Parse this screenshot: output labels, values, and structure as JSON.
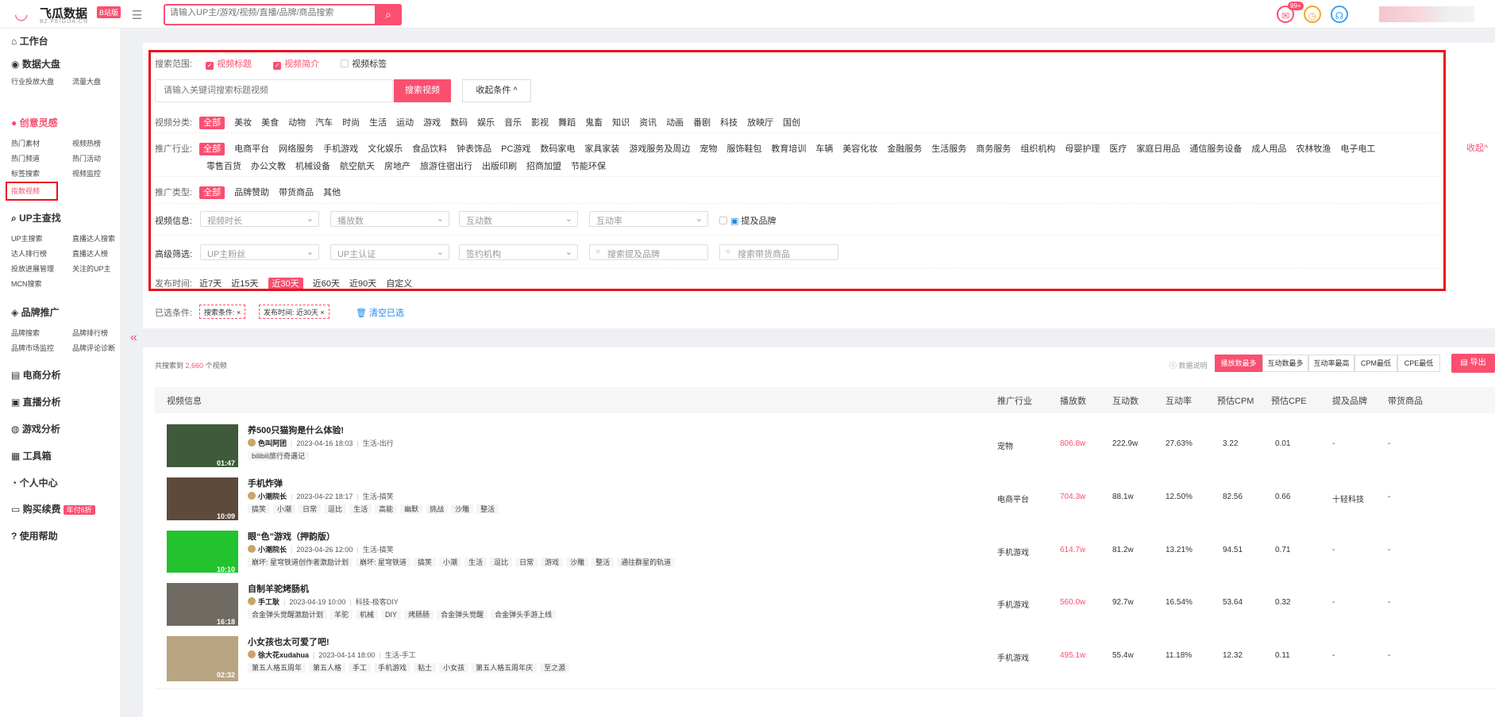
{
  "brand": {
    "name": "飞瓜数据",
    "badge": "B站版",
    "sub": "BZ.FEIGUA.CN"
  },
  "top_search": {
    "placeholder": "请输入UP主/游戏/视频/直播/品牌/商品搜索"
  },
  "top_icons": {
    "msg_count": "99+"
  },
  "sidebar": {
    "workbench": "工作台",
    "dashboard": "数据大盘",
    "dash_items": [
      "行业投放大盘",
      "流量大盘"
    ],
    "creative": "创意灵感",
    "creative_items": [
      "热门素材",
      "视频热榜",
      "热门频道",
      "热门活动",
      "标签搜索",
      "视频监控",
      "指数视频"
    ],
    "upsearch": "UP主查找",
    "up_items": [
      "UP主搜索",
      "直播达人搜索",
      "达人排行榜",
      "直播达人榜",
      "投放进展管理",
      "关注的UP主",
      "MCN搜索"
    ],
    "brand": "品牌推广",
    "brand_items": [
      "品牌搜索",
      "品牌排行榜",
      "品牌市场监控",
      "品牌评论诊断"
    ],
    "ecom": "电商分析",
    "live": "直播分析",
    "game": "游戏分析",
    "tools": "工具箱",
    "personal": "个人中心",
    "renew": "购买续费",
    "renew_tag": "年付6折",
    "help": "使用帮助"
  },
  "filters": {
    "scope_label": "搜索范围:",
    "scope_opts": [
      "视频标题",
      "视频简介",
      "视频标签"
    ],
    "kw_placeholder": "请输入关键词搜索标题视频",
    "kw_btn": "搜索视频",
    "fold_btn": "收起条件 ^",
    "cat_label": "视频分类:",
    "cats": [
      "全部",
      "美妆",
      "美食",
      "动物",
      "汽车",
      "时尚",
      "生活",
      "运动",
      "游戏",
      "数码",
      "娱乐",
      "音乐",
      "影视",
      "舞蹈",
      "鬼畜",
      "知识",
      "资讯",
      "动画",
      "番剧",
      "科技",
      "放映厅",
      "国创"
    ],
    "ind_label": "推广行业:",
    "inds1": [
      "全部",
      "电商平台",
      "网络服务",
      "手机游戏",
      "文化娱乐",
      "食品饮料",
      "钟表饰品",
      "PC游戏",
      "数码家电",
      "家具家装",
      "游戏服务及周边",
      "宠物",
      "服饰鞋包",
      "教育培训",
      "车辆",
      "美容化妆",
      "金融服务",
      "生活服务",
      "商务服务",
      "组织机构",
      "母婴护理",
      "医疗",
      "家庭日用品",
      "通信服务设备",
      "成人用品",
      "农林牧渔",
      "电子电工"
    ],
    "inds2": [
      "零售百货",
      "办公文教",
      "机械设备",
      "航空航天",
      "房地产",
      "旅游住宿出行",
      "出版印刷",
      "招商加盟",
      "节能环保"
    ],
    "ind_fold": "收起^",
    "type_label": "推广类型:",
    "types": [
      "全部",
      "品牌赞助",
      "带货商品",
      "其他"
    ],
    "info_label": "视频信息:",
    "info_sels": [
      "视频时长",
      "播放数",
      "互动数",
      "互动率"
    ],
    "mention_brand": "提及品牌",
    "adv_label": "高级筛选:",
    "adv_sels": [
      "UP主粉丝",
      "UP主认证",
      "签约机构"
    ],
    "adv_search": [
      "搜索提及品牌",
      "搜索带货商品"
    ],
    "time_label": "发布时间:",
    "times": [
      "近7天",
      "近15天",
      "近30天",
      "近60天",
      "近90天",
      "自定义"
    ]
  },
  "chosen": {
    "label": "已选条件:",
    "chips": [
      "搜索条件: ×",
      "发布时间: 近30天 ×"
    ],
    "clear": "清空已选"
  },
  "results": {
    "count_pre": "共搜索到",
    "count": "2,660",
    "count_post": "个视频",
    "data_note": "数据说明",
    "sorts": [
      "播放数最多",
      "互动数最多",
      "互动率最高",
      "CPM最低",
      "CPE最低"
    ],
    "export": "导出",
    "headers": [
      "视频信息",
      "推广行业",
      "播放数",
      "互动数",
      "互动率",
      "预估CPM",
      "预估CPE",
      "提及品牌",
      "带货商品"
    ],
    "rows": [
      {
        "title": "养500只猫狗是什么体验!",
        "author": "色叫阿团",
        "date": "2023-04-16 18:03",
        "cat": "生活-出行",
        "tags": [
          "bilibili旅行奇遇记"
        ],
        "dur": "01:47",
        "industry": "宠物",
        "plays": "806.8w",
        "inter": "222.9w",
        "rate": "27.63%",
        "cpm": "3.22",
        "cpe": "0.01",
        "brand": "-",
        "goods": "-",
        "thumb": "#3e5a3a"
      },
      {
        "title": "手机炸弹",
        "author": "小潮院长",
        "date": "2023-04-22 18:17",
        "cat": "生活-搞笑",
        "tags": [
          "搞笑",
          "小潮",
          "日常",
          "逗比",
          "生活",
          "高能",
          "幽默",
          "挑战",
          "沙雕",
          "整活"
        ],
        "dur": "10:09",
        "industry": "电商平台",
        "plays": "704.3w",
        "inter": "88.1w",
        "rate": "12.50%",
        "cpm": "82.56",
        "cpe": "0.66",
        "brand": "十轻科技",
        "goods": "-",
        "thumb": "#5d4a3a"
      },
      {
        "title": "眼“色”游戏（押韵版）",
        "author": "小潮院长",
        "date": "2023-04-26 12:00",
        "cat": "生活-搞笑",
        "tags": [
          "崩坏: 星穹铁道创作者激励计划",
          "崩坏: 星穹铁道",
          "搞笑",
          "小潮",
          "生活",
          "逗比",
          "日常",
          "游戏",
          "沙雕",
          "整活",
          "通往群星的轨道"
        ],
        "dur": "10:10",
        "industry": "手机游戏",
        "plays": "614.7w",
        "inter": "81.2w",
        "rate": "13.21%",
        "cpm": "94.51",
        "cpe": "0.71",
        "brand": "-",
        "goods": "-",
        "thumb": "#22c32e"
      },
      {
        "title": "自制羊驼烤肠机",
        "author": "手工耿",
        "date": "2023-04-19 10:00",
        "cat": "科技-极客DIY",
        "tags": [
          "合金弹头觉醒激励计划",
          "羊驼",
          "机械",
          "DIY",
          "烤肠肠",
          "合金弹头觉醒",
          "合金弹头手游上线"
        ],
        "dur": "16:18",
        "industry": "手机游戏",
        "plays": "560.0w",
        "inter": "92.7w",
        "rate": "16.54%",
        "cpm": "53.64",
        "cpe": "0.32",
        "brand": "-",
        "goods": "-",
        "thumb": "#6f6a62"
      },
      {
        "title": "小女孩也太可爱了吧!",
        "author": "徐大花xudahua",
        "date": "2023-04-14 18:00",
        "cat": "生活-手工",
        "tags": [
          "第五人格五周年",
          "第五人格",
          "手工",
          "手机游戏",
          "粘土",
          "小女孩",
          "第五人格五周年庆",
          "至之源"
        ],
        "dur": "02:32",
        "industry": "手机游戏",
        "plays": "495.1w",
        "inter": "55.4w",
        "rate": "11.18%",
        "cpm": "12.32",
        "cpe": "0.11",
        "brand": "-",
        "goods": "-",
        "thumb": "#b9a583"
      }
    ]
  }
}
